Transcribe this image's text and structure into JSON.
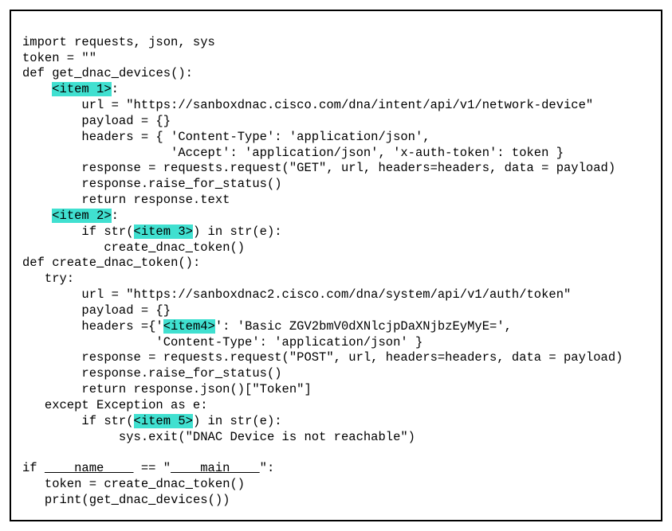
{
  "code": {
    "l1": "import requests, json, sys",
    "l2": "token = \"\"",
    "l3_a": "def get",
    "l3_b": "dnac",
    "l3_c": "devices():",
    "l4_item1": "<item 1>",
    "l4_colon": ":",
    "l5": "        url = \"https://sanboxdnac.cisco.com/dna/intent/api/v1/network-device\"",
    "l6": "        payload = {}",
    "l7": "        headers = { 'Content-Type': 'application/json',",
    "l8": "                    'Accept': 'application/json', 'x-auth-token': token }",
    "l9": "        response = requests.request(\"GET\", url, headers=headers, data = payload)",
    "l10_a": "        response.raise",
    "l10_b": "for",
    "l10_c": "status()",
    "l11": "        return response.text",
    "l12_item2": "<item 2>",
    "l12_colon": ":",
    "l13_a": "        if str(",
    "l13_item3": "<item 3>",
    "l13_b": ") in str(e):",
    "l14_a": "           create",
    "l14_b": "dnac",
    "l14_c": "token()",
    "l15_a": "def create",
    "l15_b": "dnac",
    "l15_c": "token():",
    "l16": "   try:",
    "l17": "        url = \"https://sanboxdnac2.cisco.com/dna/system/api/v1/auth/token\"",
    "l18": "        payload = {}",
    "l19_a": "        headers ={'",
    "l19_item4": "<item4>",
    "l19_b": "': 'Basic ZGV2bmV0dXNlcjpDaXNjbzEyMyE=',",
    "l20": "                  'Content-Type': 'application/json' }",
    "l21": "        response = requests.request(\"POST\", url, headers=headers, data = payload)",
    "l22_a": "        response.raise",
    "l22_b": "for",
    "l22_c": "status()",
    "l23": "        return response.json()[\"Token\"]",
    "l24": "   except Exception as e:",
    "l25_a": "        if str(",
    "l25_item5": "<item 5>",
    "l25_b": ") in str(e):",
    "l26": "             sys.exit(\"DNAC Device is not reachable\")",
    "blank": "",
    "l27_a": "if ",
    "l27_name": "    name    ",
    "l27_mid": " == \"",
    "l27_main": "    main    ",
    "l27_end": "\":",
    "l28_a": "   token = create",
    "l28_b": "dnac",
    "l28_c": "token()",
    "l29_a": "   print(get",
    "l29_b": "dnac",
    "l29_c": "devices())"
  }
}
